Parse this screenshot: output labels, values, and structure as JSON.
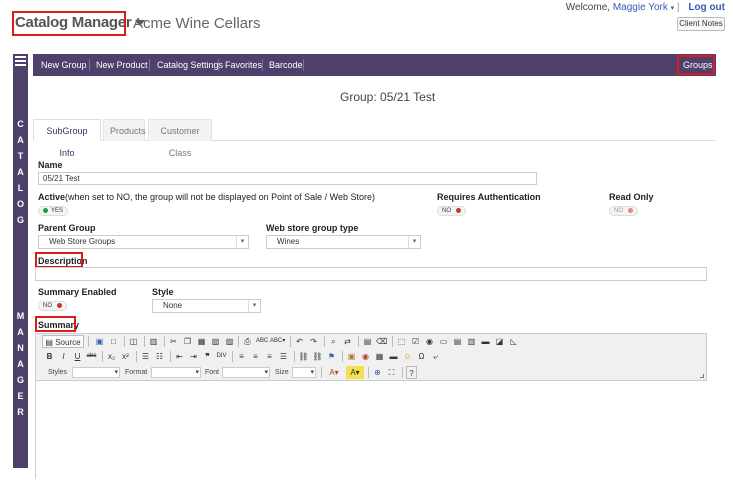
{
  "header": {
    "app_title": "Catalog Manager",
    "company": "Acme Wine Cellars",
    "welcome_text": "Welcome,",
    "user_name": "Maggie York",
    "logout": "Log out",
    "client_notes": "Client Notes"
  },
  "sidebar": {
    "label_top": [
      "C",
      "A",
      "T",
      "A",
      "L",
      "O",
      "G"
    ],
    "label_bottom": [
      "M",
      "A",
      "N",
      "A",
      "G",
      "E",
      "R"
    ]
  },
  "navbar": {
    "items": [
      "New Group",
      "New Product",
      "Catalog Settings",
      "Favorites",
      "Barcode"
    ],
    "groups": "Groups"
  },
  "page": {
    "title": "Group: 05/21 Test"
  },
  "tabs": [
    "SubGroup Info",
    "Products",
    "Customer Class"
  ],
  "form": {
    "name_label": "Name",
    "name_value": "05/21 Test",
    "active_label": "Active",
    "active_hint": "(when set to NO, the group will not be displayed on Point of Sale / Web Store)",
    "active_value": "YES",
    "requires_auth_label": "Requires Authentication",
    "requires_auth_value": "NO",
    "read_only_label": "Read Only",
    "read_only_value": "NO",
    "parent_group_label": "Parent Group",
    "parent_group_value": "Web Store Groups",
    "webstore_type_label": "Web store group type",
    "webstore_type_value": "Wines",
    "description_label": "Description",
    "description_value": "",
    "summary_enabled_label": "Summary Enabled",
    "summary_enabled_value": "NO",
    "style_label": "Style",
    "style_value": "None",
    "summary_label": "Summary"
  },
  "editor": {
    "source": "Source",
    "styles": "Styles",
    "format": "Format",
    "font": "Font",
    "size": "Size"
  },
  "colors": {
    "nav_bg": "#4f3f6b",
    "highlight": "#d91c1c",
    "toggle_yes": "#2a9a3a",
    "toggle_no": "#c0392b"
  }
}
